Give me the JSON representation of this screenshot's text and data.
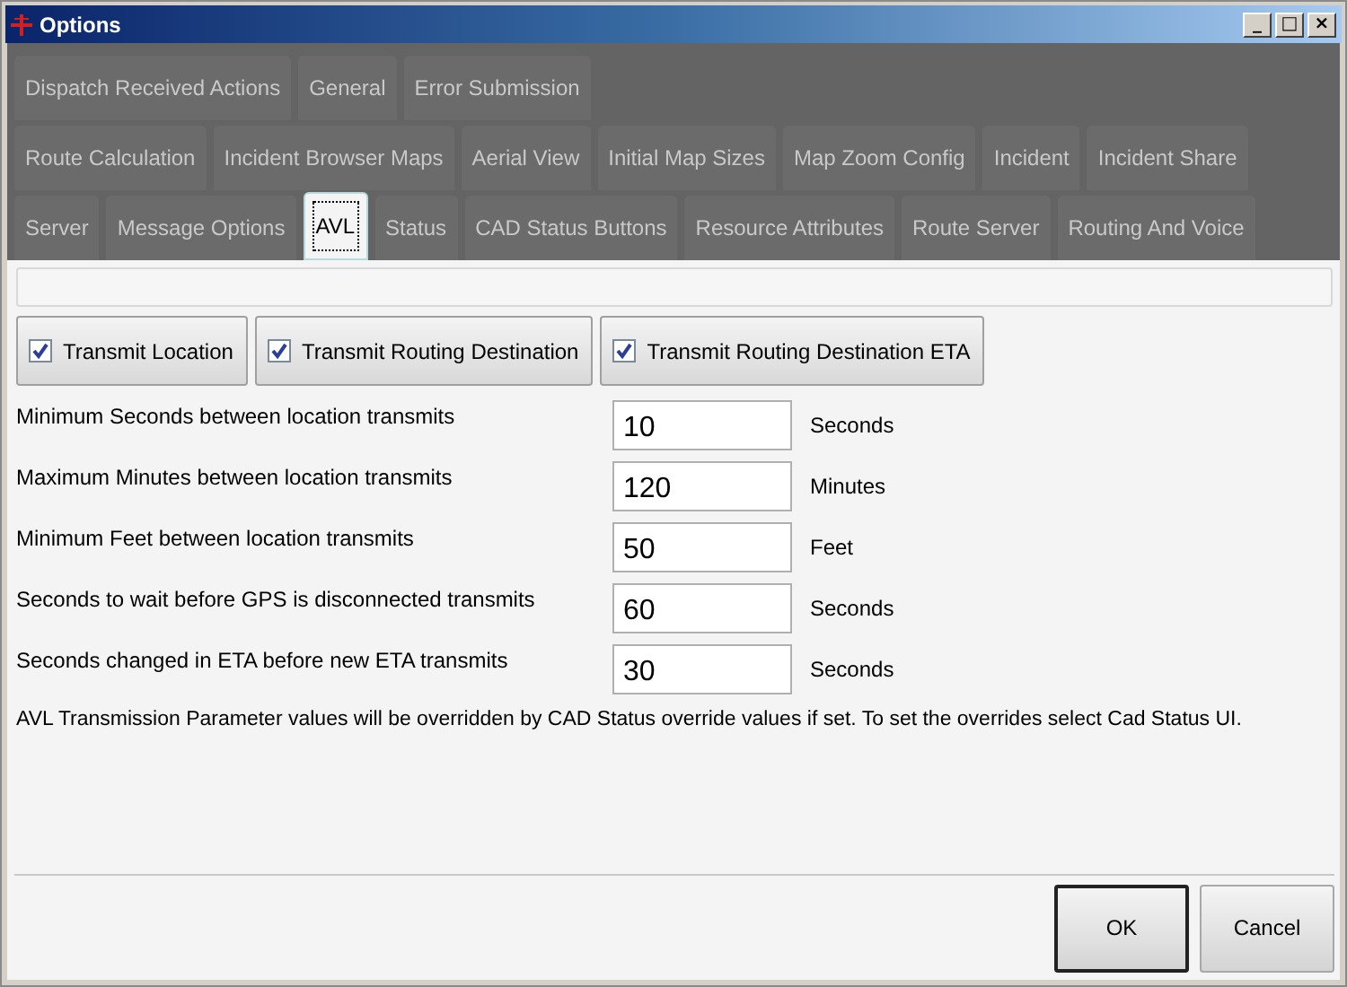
{
  "window": {
    "title": "Options",
    "controls": [
      "_",
      "□",
      "×"
    ]
  },
  "tab_rows": [
    [
      {
        "label": "Dispatch Received Actions",
        "selected": false
      },
      {
        "label": "General",
        "selected": false
      },
      {
        "label": "Error Submission",
        "selected": false
      }
    ],
    [
      {
        "label": "Route Calculation",
        "selected": false
      },
      {
        "label": "Incident Browser Maps",
        "selected": false
      },
      {
        "label": "Aerial View",
        "selected": false
      },
      {
        "label": "Initial Map Sizes",
        "selected": false
      },
      {
        "label": "Map Zoom Config",
        "selected": false
      },
      {
        "label": "Incident",
        "selected": false
      },
      {
        "label": "Incident Share",
        "selected": false
      }
    ],
    [
      {
        "label": "Server",
        "selected": false
      },
      {
        "label": "Message Options",
        "selected": false
      },
      {
        "label": "AVL",
        "selected": true
      },
      {
        "label": "Status",
        "selected": false
      },
      {
        "label": "CAD Status Buttons",
        "selected": false
      },
      {
        "label": "Resource Attributes",
        "selected": false
      },
      {
        "label": "Route Server",
        "selected": false
      },
      {
        "label": "Routing And Voice",
        "selected": false
      }
    ]
  ],
  "toggles": [
    {
      "label": "Transmit Location",
      "checked": true
    },
    {
      "label": "Transmit Routing Destination",
      "checked": true
    },
    {
      "label": "Transmit Routing Destination ETA",
      "checked": true
    }
  ],
  "fields": [
    {
      "label": "Minimum Seconds between location transmits",
      "value": "10",
      "unit": "Seconds"
    },
    {
      "label": "Maximum Minutes between location transmits",
      "value": "120",
      "unit": "Minutes"
    },
    {
      "label": "Minimum Feet between location transmits",
      "value": "50",
      "unit": "Feet"
    },
    {
      "label": "Seconds to wait before GPS is disconnected transmits",
      "value": "60",
      "unit": "Seconds"
    },
    {
      "label": "Seconds changed in ETA before new ETA transmits",
      "value": "30",
      "unit": "Seconds"
    }
  ],
  "note": "AVL Transmission Parameter values will be overridden by CAD Status override values if set. To set the overrides select Cad Status UI.",
  "buttons": [
    {
      "label": "OK",
      "default": true
    },
    {
      "label": "Cancel",
      "default": false
    }
  ]
}
